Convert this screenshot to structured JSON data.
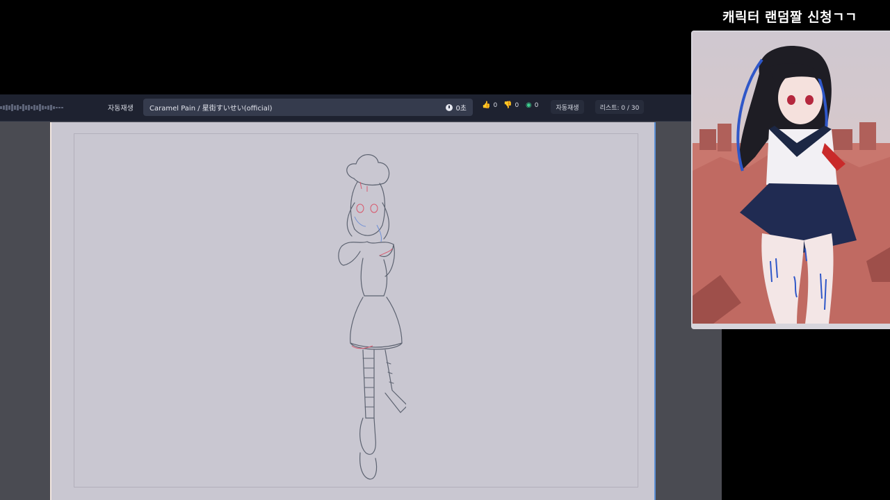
{
  "player": {
    "autoplay_label": "자동재생",
    "song_title": "Caramel Pain / 星街すいせい(official)",
    "elapsed": "0초",
    "likes": "0",
    "dislikes": "0",
    "views": "0",
    "autoplay_button": "자동재생",
    "list_counter": "리스트: 0 / 30"
  },
  "overlay": {
    "request_title": "캐릭터 랜덤짤 신청ㄱㄱ"
  },
  "icons": {
    "like": "thumbs-up-icon",
    "dislike": "thumbs-down-icon",
    "views": "eye-icon",
    "time": "clock-icon"
  },
  "colors": {
    "bar": "#1e2230",
    "song_box": "#353b4d",
    "like": "#6f9ff0",
    "dislike": "#e05a6a",
    "views": "#3ecf8e",
    "paper": "#c9c7d1"
  }
}
